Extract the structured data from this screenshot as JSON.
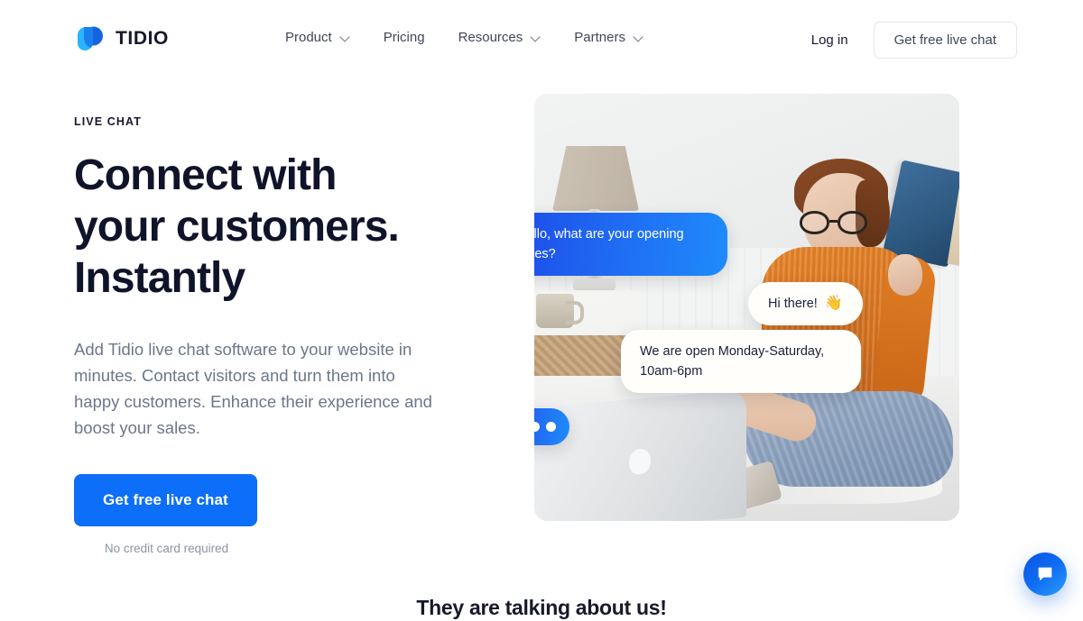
{
  "brand": {
    "name": "TIDIO",
    "logo_icon": "tidio-logo-icon",
    "colors": {
      "logo_light": "#29B6FF",
      "logo_dark": "#1464E0"
    }
  },
  "header": {
    "nav": [
      {
        "label": "Product",
        "has_dropdown": true,
        "icon": "chevron-down-icon"
      },
      {
        "label": "Pricing",
        "has_dropdown": false,
        "icon": ""
      },
      {
        "label": "Resources",
        "has_dropdown": true,
        "icon": "chevron-down-icon"
      },
      {
        "label": "Partners",
        "has_dropdown": true,
        "icon": "chevron-down-icon"
      }
    ],
    "login_label": "Log in",
    "cta_label": "Get free live chat"
  },
  "hero": {
    "eyebrow": "LIVE CHAT",
    "headline": "Connect with your customers. Instantly",
    "subcopy": "Add Tidio live chat software to your website in minutes. Contact visitors and turn them into happy customers. Enhance their experience and boost your sales.",
    "cta_label": "Get free live chat",
    "cta_note": "No credit card required",
    "cta_color": "#0C6EF9"
  },
  "hero_media": {
    "alt": "Person in an orange sweater sitting cross-legged on a bed with a laptop, reading a book",
    "bubbles": [
      {
        "id": "visitor-message",
        "text": "Hello, what are your opening times?",
        "style": "blue-gradient"
      },
      {
        "id": "agent-greeting",
        "text": "Hi there!",
        "emoji": "👋",
        "style": "white"
      },
      {
        "id": "agent-hours",
        "text": "We are open Monday-Saturday, 10am-6pm",
        "style": "white"
      },
      {
        "id": "typing-indicator",
        "text": "",
        "style": "blue-gradient-dots"
      }
    ]
  },
  "chat_widget": {
    "icon": "chat-bubble-icon",
    "color": "#0F6DF4"
  },
  "social_proof": {
    "title": "They are talking about us!"
  }
}
